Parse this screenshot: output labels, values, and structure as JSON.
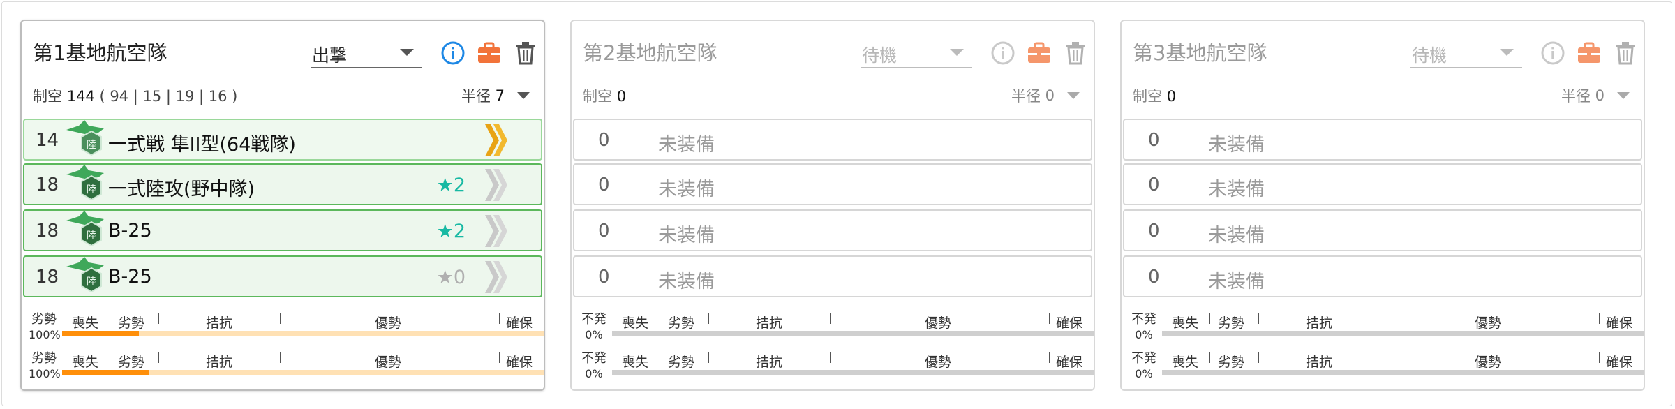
{
  "colors": {
    "accent_blue": "#1e88e5",
    "briefcase": "#f2733a",
    "slot_border": "#5cb85c",
    "star": "#18b9a3",
    "gauge_fill": "#ff8f0a",
    "gauge_bg": "#ffe1b4"
  },
  "gauge_labels": {
    "left_active": "劣勢",
    "left_inactive": "不発",
    "lost": "喪失",
    "denial": "劣勢",
    "parity": "拮抗",
    "superiority": "優勢",
    "supremacy": "確保"
  },
  "panels": [
    {
      "title": "第1基地航空隊",
      "mode": "出撃",
      "air_label": "制空",
      "air_value": "144",
      "air_detail": "( 94 | 15 | 19 | 16 )",
      "radius_label": "半径",
      "radius_value": "7",
      "icons": [
        "info-icon",
        "briefcase-icon",
        "trash-icon"
      ],
      "slots": [
        {
          "count": "14",
          "name": "一式戦 隼II型(64戦隊)",
          "star": "",
          "prof": "gold-double-chevron-icon",
          "equipped": true
        },
        {
          "count": "18",
          "name": "一式陸攻(野中隊)",
          "star": "★2",
          "prof": "gray-double-chevron-icon",
          "equipped": true
        },
        {
          "count": "18",
          "name": "B-25",
          "star": "★2",
          "prof": "gray-double-chevron-icon",
          "equipped": true
        },
        {
          "count": "18",
          "name": "B-25",
          "star": "★0",
          "prof": "gray-double-chevron-icon",
          "equipped": true
        }
      ],
      "gauges": [
        {
          "state": "劣勢",
          "percent": "100%",
          "fill": 0.16
        },
        {
          "state": "劣勢",
          "percent": "100%",
          "fill": 0.18
        }
      ]
    },
    {
      "title": "第2基地航空隊",
      "mode": "待機",
      "air_label": "制空",
      "air_value": "0",
      "radius_label": "半径",
      "radius_value": "0",
      "slots": [
        {
          "count": "0",
          "name": "未装備"
        },
        {
          "count": "0",
          "name": "未装備"
        },
        {
          "count": "0",
          "name": "未装備"
        },
        {
          "count": "0",
          "name": "未装備"
        }
      ],
      "gauges": [
        {
          "state": "不発",
          "percent": "0%",
          "fill": 0
        },
        {
          "state": "不発",
          "percent": "0%",
          "fill": 0
        }
      ]
    },
    {
      "title": "第3基地航空隊",
      "mode": "待機",
      "air_label": "制空",
      "air_value": "0",
      "radius_label": "半径",
      "radius_value": "0",
      "slots": [
        {
          "count": "0",
          "name": "未装備"
        },
        {
          "count": "0",
          "name": "未装備"
        },
        {
          "count": "0",
          "name": "未装備"
        },
        {
          "count": "0",
          "name": "未装備"
        }
      ],
      "gauges": [
        {
          "state": "不発",
          "percent": "0%",
          "fill": 0
        },
        {
          "state": "不発",
          "percent": "0%",
          "fill": 0
        }
      ]
    }
  ]
}
